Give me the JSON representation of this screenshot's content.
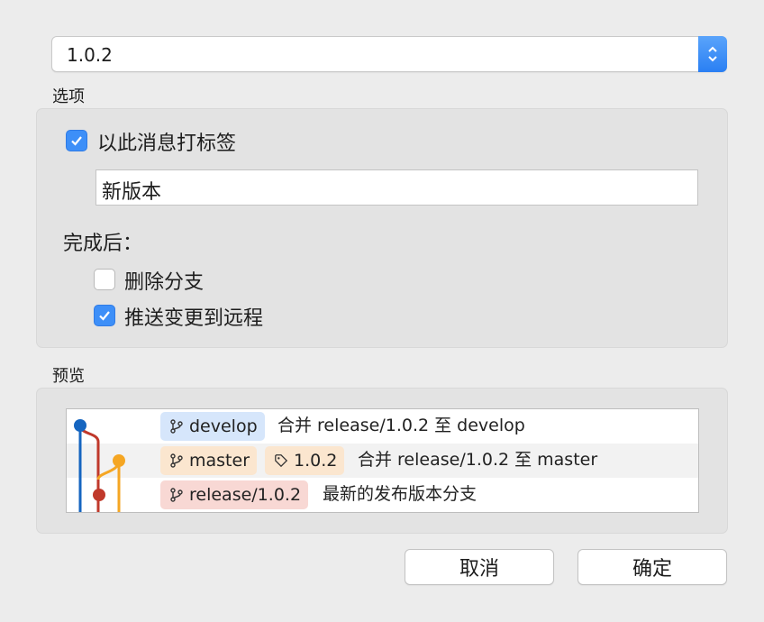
{
  "version_select": {
    "value": "1.0.2"
  },
  "options": {
    "label": "选项",
    "tag_checkbox": {
      "label": "以此消息打标签",
      "checked": true
    },
    "tag_message": {
      "value": "新版本"
    },
    "after_heading": "完成后：",
    "delete_branch": {
      "label": "删除分支",
      "checked": false
    },
    "push_remote": {
      "label": "推送变更到远程",
      "checked": true
    }
  },
  "preview": {
    "label": "预览",
    "rows": [
      {
        "branch": "develop",
        "message": "合并 release/1.0.2 至 develop"
      },
      {
        "branch": "master",
        "tag": "1.0.2",
        "message": "合并 release/1.0.2 至 master"
      },
      {
        "branch": "release/1.0.2",
        "message": "最新的发布版本分支"
      }
    ],
    "colors": {
      "develop": "#1565c0",
      "master": "#f5a623",
      "release": "#c0392b",
      "develop_chip": "#d6e6fb",
      "master_chip": "#fbe6cf",
      "release_chip": "#f8d8d4"
    }
  },
  "buttons": {
    "cancel": "取消",
    "ok": "确定"
  }
}
